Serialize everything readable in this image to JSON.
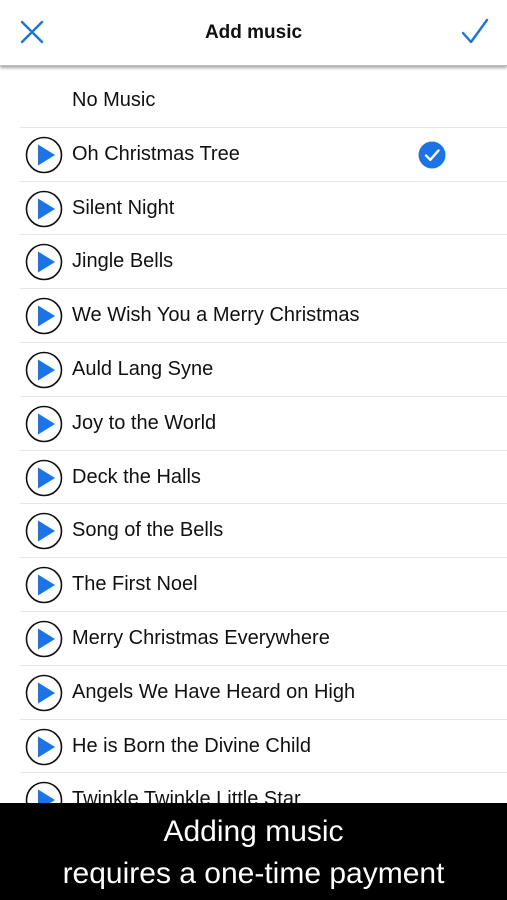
{
  "header": {
    "title": "Add music",
    "close_icon": "close-icon",
    "done_icon": "checkmark-icon",
    "accent_color": "#1a73e8"
  },
  "songs": [
    {
      "label": "No Music",
      "has_play": false,
      "selected": false
    },
    {
      "label": "Oh Christmas Tree",
      "has_play": true,
      "selected": true
    },
    {
      "label": "Silent Night",
      "has_play": true,
      "selected": false
    },
    {
      "label": "Jingle Bells",
      "has_play": true,
      "selected": false
    },
    {
      "label": "We Wish You a Merry Christmas",
      "has_play": true,
      "selected": false
    },
    {
      "label": "Auld Lang Syne",
      "has_play": true,
      "selected": false
    },
    {
      "label": "Joy to the World",
      "has_play": true,
      "selected": false
    },
    {
      "label": "Deck the Halls",
      "has_play": true,
      "selected": false
    },
    {
      "label": "Song of the Bells",
      "has_play": true,
      "selected": false
    },
    {
      "label": "The First Noel",
      "has_play": true,
      "selected": false
    },
    {
      "label": "Merry Christmas Everywhere",
      "has_play": true,
      "selected": false
    },
    {
      "label": "Angels We Have Heard on High",
      "has_play": true,
      "selected": false
    },
    {
      "label": "He is Born the Divine Child",
      "has_play": true,
      "selected": false
    },
    {
      "label": "Twinkle Twinkle Little Star",
      "has_play": true,
      "selected": false
    }
  ],
  "banner": {
    "line1": "Adding music",
    "line2": "requires a one-time payment"
  }
}
